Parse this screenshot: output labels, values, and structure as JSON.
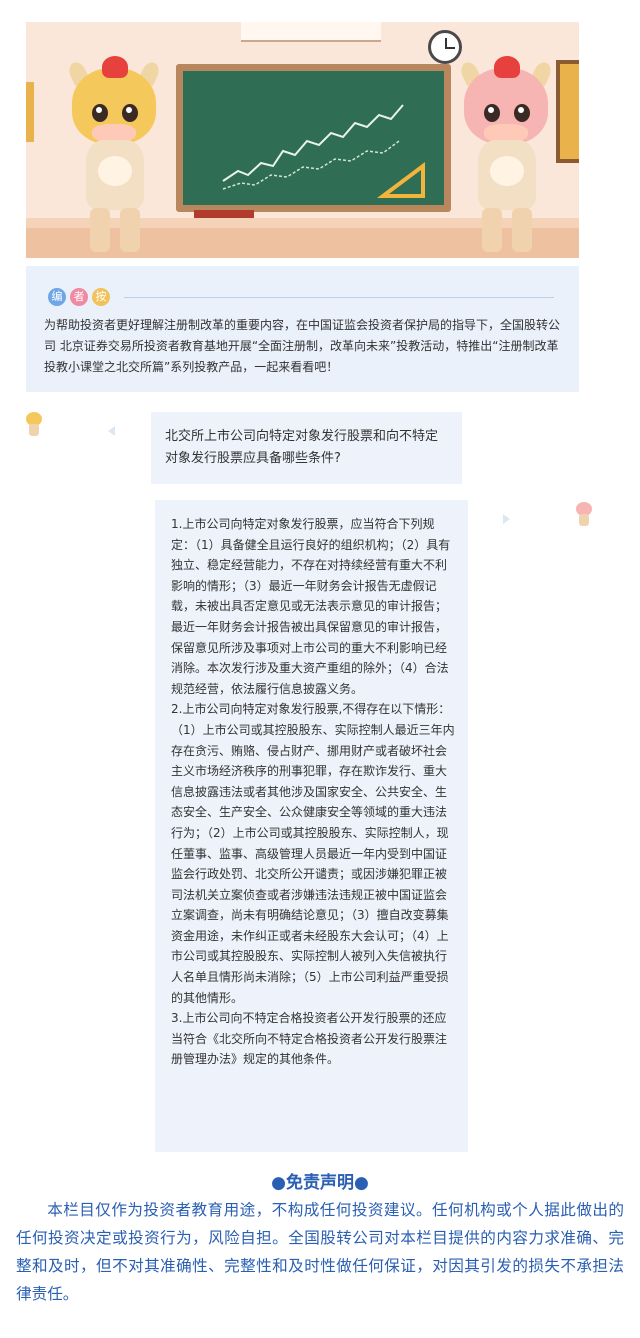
{
  "note": {
    "badges": [
      "编",
      "者",
      "按"
    ],
    "text": "为帮助投资者更好理解注册制改革的重要内容，在中国证监会投资者保护局的指导下，全国股转公司 北京证券交易所投资者教育基地开展“全面注册制，改革向未来”投教活动，特推出“注册制改革投教小课堂之北交所篇”系列投教产品，一起来看看吧！"
  },
  "chat": {
    "question": "北交所上市公司向特定对象发行股票和向不特定对象发行股票应具备哪些条件?",
    "answer": [
      "1.上市公司向特定对象发行股票，应当符合下列规定：（1）具备健全且运行良好的组织机构；（2）具有独立、稳定经营能力，不存在对持续经营有重大不利影响的情形；（3）最近一年财务会计报告无虚假记载，未被出具否定意见或无法表示意见的审计报告；最近一年财务会计报告被出具保留意见的审计报告，保留意见所涉及事项对上市公司的重大不利影响已经消除。本次发行涉及重大资产重组的除外；（4）合法规范经营，依法履行信息披露义务。",
      "2.上市公司向特定对象发行股票,不得存在以下情形：（1）上市公司或其控股股东、实际控制人最近三年内存在贪污、贿赂、侵占财产、挪用财产或者破坏社会主义市场经济秩序的刑事犯罪，存在欺诈发行、重大信息披露违法或者其他涉及国家安全、公共安全、生态安全、生产安全、公众健康安全等领域的重大违法行为；（2）上市公司或其控股股东、实际控制人，现任董事、监事、高级管理人员最近一年内受到中国证监会行政处罚、北交所公开谴责；或因涉嫌犯罪正被司法机关立案侦查或者涉嫌违法违规正被中国证监会立案调查，尚未有明确结论意见；（3）擅自改变募集资金用途，未作纠正或者未经股东大会认可；（4）上市公司或其控股股东、实际控制人被列入失信被执行人名单且情形尚未消除；（5）上市公司利益严重受损的其他情形。",
      "3.上市公司向不特定合格投资者公开发行股票的还应当符合《北交所向不特定合格投资者公开发行股票注册管理办法》规定的其他条件。"
    ]
  },
  "disclaimer": {
    "title": "●免责声明●",
    "body": "本栏目仅作为投资者教育用途，不构成任何投资建议。任何机构或个人据此做出的任何投资决定或投资行为，风险自担。全国股转公司对本栏目提供的内容力求准确、完整和及时，但不对其准确性、完整性和及时性做任何保证，对因其引发的损失不承担法律责任。"
  },
  "colors": {
    "accent_blue": "#2a5fb3",
    "card_bg": "#eaf1fb",
    "bubble_bg": "#eef3fb"
  }
}
